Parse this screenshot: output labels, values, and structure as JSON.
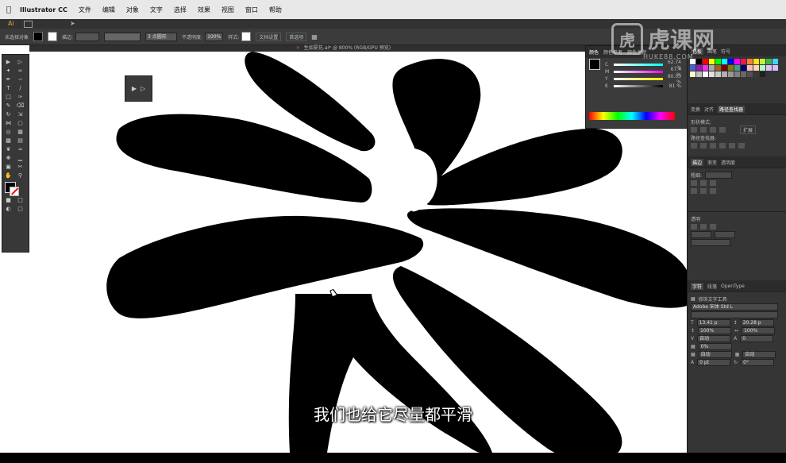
{
  "menubar": {
    "apple": "",
    "app_name": "Illustrator CC",
    "items": [
      "文件",
      "编辑",
      "对象",
      "文字",
      "选择",
      "效果",
      "视图",
      "窗口",
      "帮助"
    ]
  },
  "control_bar": {
    "selection_label": "未选择对象",
    "stroke_label": "描边:",
    "stroke_profile": "3 点圆形",
    "opacity_label": "不透明度:",
    "opacity_value": "100%",
    "style_label": "样式:",
    "doc_setup_button": "文档设置",
    "prefs_button": "首选项"
  },
  "document_tab": {
    "title": "生如夏花.ai* @ 800% (RGB/GPU 预览)"
  },
  "color_panel": {
    "tabs": [
      "颜色",
      "颜色参考",
      "颜色主题"
    ],
    "channels": [
      {
        "label": "C",
        "value": "62.74 %"
      },
      {
        "label": "M",
        "value": "67.4 %"
      },
      {
        "label": "Y",
        "value": "80.03 %"
      },
      {
        "label": "K",
        "value": "81 %"
      }
    ]
  },
  "right_panel": {
    "swatch_tabs": [
      "色板",
      "画笔",
      "符号"
    ],
    "swatch_colors": [
      "#ffffff",
      "#000000",
      "#ff0000",
      "#ffff00",
      "#00ff00",
      "#00ffff",
      "#0000ff",
      "#ff00ff",
      "#e6194b",
      "#f58231",
      "#ffe119",
      "#bfef45",
      "#3cb44b",
      "#42d4f4",
      "#4363d8",
      "#911eb4",
      "#f032e6",
      "#a9a9a9",
      "#9a6324",
      "#800000",
      "#808000",
      "#469990",
      "#000075",
      "#fabebe",
      "#ffd8b1",
      "#aaffc3",
      "#e6beff",
      "#dcbeff",
      "#fffac8",
      "#c0c0c0",
      "#ffffff",
      "#e0e0e0",
      "#c8c8c8",
      "#b0b0b0",
      "#989898",
      "#808080",
      "#686868",
      "#505050",
      "#383838",
      "#202020"
    ],
    "align_tabs": [
      "变换",
      "对齐",
      "路径查找器"
    ],
    "shape_modes_label": "形状模式:",
    "expand_button": "扩展",
    "pathfinder_label": "路径查找器:",
    "stroke_tabs": [
      "描边",
      "渐变",
      "透明度"
    ],
    "weight_label": "粗细:",
    "transparency_label": "透明",
    "char_tabs": [
      "字符",
      "段落",
      "OpenType"
    ],
    "touch_type_label": "修饰文字工具",
    "font_family": "Adobe 宋体 Std L",
    "font_style": "",
    "font_size": "13.41 p",
    "leading": "20.28 p",
    "horiz_scale": "100%",
    "vert_scale": "100%",
    "kerning": "自动",
    "tracking": "0",
    "tsume": "0%",
    "aki_left": "自动",
    "aki_right": "自动",
    "baseline": "0 pt",
    "rotation": "0°"
  },
  "watermark": {
    "logo_glyph": "虎",
    "text": "虎课网",
    "url": "HUKE88.COM"
  },
  "subtitle": "我们也给它尽量都平滑"
}
